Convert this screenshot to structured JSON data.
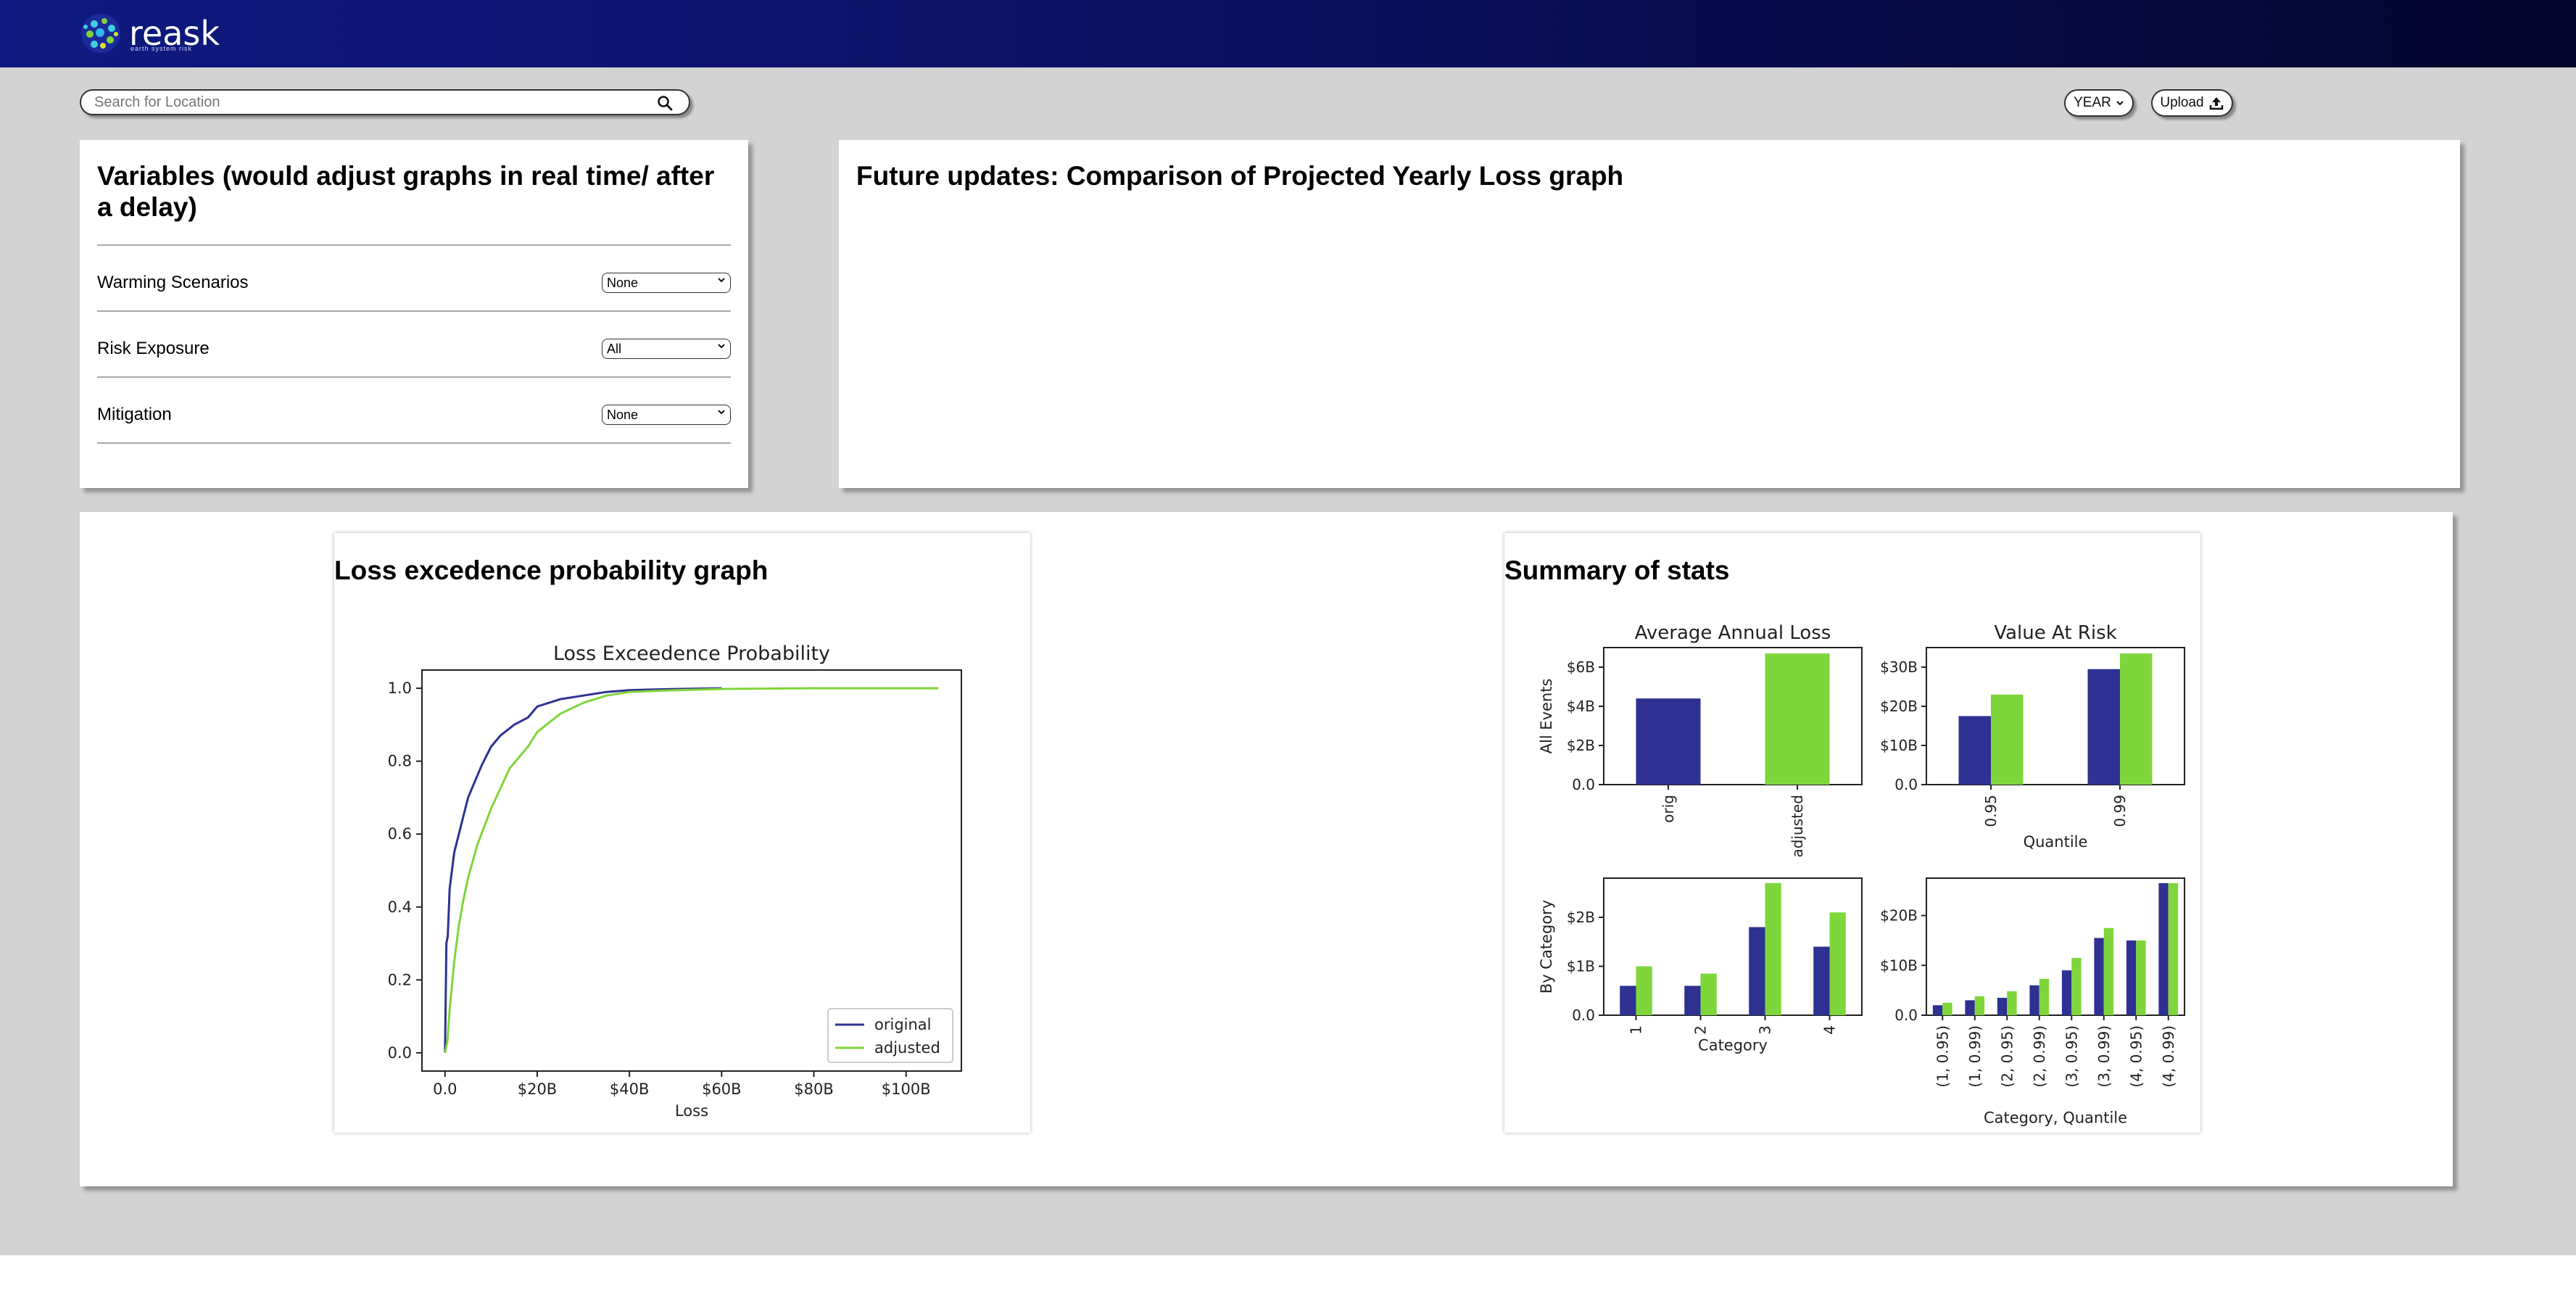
{
  "brand": {
    "name": "reask",
    "tagline": "earth system risk"
  },
  "search": {
    "placeholder": "Search for Location"
  },
  "toolbar": {
    "period": "YEAR",
    "upload_label": "Upload"
  },
  "variables": {
    "title": "Variables (would adjust graphs in real time/ after a delay)",
    "items": [
      {
        "label": "Warming Scenarios",
        "value": "None"
      },
      {
        "label": "Risk Exposure",
        "value": "All"
      },
      {
        "label": "Mitigation",
        "value": "None"
      }
    ]
  },
  "future": {
    "title": "Future updates: Comparison of Projected Yearly Loss graph"
  },
  "loss_section": {
    "title": "Loss excedence probability graph"
  },
  "stats_section": {
    "title": "Summary of stats"
  },
  "colors": {
    "original": "#2e3192",
    "adjusted": "#7fd63b"
  },
  "chart_data": [
    {
      "type": "line",
      "title": "Loss Exceedence Probability",
      "xlabel": "Loss",
      "ylabel": "",
      "xlim": [
        -5,
        112
      ],
      "ylim": [
        -0.05,
        1.05
      ],
      "xticks": [
        0,
        20,
        40,
        60,
        80,
        100
      ],
      "xtick_labels": [
        "0.0",
        "$20B",
        "$40B",
        "$60B",
        "$80B",
        "$100B"
      ],
      "yticks": [
        0,
        0.2,
        0.4,
        0.6,
        0.8,
        1.0
      ],
      "ytick_labels": [
        "0.0",
        "0.2",
        "0.4",
        "0.6",
        "0.8",
        "1.0"
      ],
      "legend": "lower-right",
      "series": [
        {
          "name": "original",
          "x": [
            0,
            0.3,
            0.6,
            1,
            2,
            3,
            4,
            5,
            6,
            8,
            10,
            12,
            15,
            18,
            20,
            25,
            30,
            35,
            40,
            50,
            60
          ],
          "y": [
            0.0,
            0.3,
            0.32,
            0.45,
            0.55,
            0.6,
            0.65,
            0.7,
            0.73,
            0.79,
            0.84,
            0.87,
            0.9,
            0.92,
            0.95,
            0.97,
            0.98,
            0.99,
            0.995,
            0.998,
            1.0
          ]
        },
        {
          "name": "adjusted",
          "x": [
            0,
            0.5,
            1,
            2,
            3,
            4,
            5,
            7,
            10,
            14,
            18,
            20,
            25,
            30,
            35,
            40,
            50,
            60,
            80,
            100,
            107
          ],
          "y": [
            0.0,
            0.03,
            0.12,
            0.25,
            0.35,
            0.42,
            0.48,
            0.57,
            0.67,
            0.78,
            0.84,
            0.88,
            0.93,
            0.96,
            0.98,
            0.99,
            0.995,
            0.998,
            1.0,
            1.0,
            1.0
          ]
        }
      ]
    },
    {
      "type": "bar",
      "title": "Average Annual Loss",
      "ylabel": "All Events",
      "categories": [
        "orig",
        "adjusted"
      ],
      "values": [
        4.4,
        6.7
      ],
      "ylim": [
        0,
        7
      ],
      "yticks": [
        0,
        2,
        4,
        6
      ],
      "ytick_labels": [
        "0.0",
        "$2B",
        "$4B",
        "$6B"
      ]
    },
    {
      "type": "bar",
      "title": "Value At Risk",
      "xlabel": "Quantile",
      "categories": [
        "0.95",
        "0.99"
      ],
      "series": [
        {
          "name": "original",
          "values": [
            17.5,
            29.5
          ]
        },
        {
          "name": "adjusted",
          "values": [
            23,
            33.5
          ]
        }
      ],
      "ylim": [
        0,
        35
      ],
      "yticks": [
        0,
        10,
        20,
        30
      ],
      "ytick_labels": [
        "0.0",
        "$10B",
        "$20B",
        "$30B"
      ]
    },
    {
      "type": "bar",
      "ylabel": "By Category",
      "xlabel": "Category",
      "categories": [
        "1",
        "2",
        "3",
        "4"
      ],
      "series": [
        {
          "name": "original",
          "values": [
            0.6,
            0.6,
            1.8,
            1.4
          ]
        },
        {
          "name": "adjusted",
          "values": [
            1.0,
            0.85,
            2.7,
            2.1
          ]
        }
      ],
      "ylim": [
        0,
        2.8
      ],
      "yticks": [
        0,
        1,
        2
      ],
      "ytick_labels": [
        "0.0",
        "$1B",
        "$2B"
      ]
    },
    {
      "type": "bar",
      "xlabel": "Category, Quantile",
      "categories": [
        "(1, 0.95)",
        "(1, 0.99)",
        "(2, 0.95)",
        "(2, 0.99)",
        "(3, 0.95)",
        "(3, 0.99)",
        "(4, 0.95)",
        "(4, 0.99)"
      ],
      "series": [
        {
          "name": "original",
          "values": [
            2,
            3,
            3.5,
            6,
            9,
            15.5,
            15,
            26.5
          ]
        },
        {
          "name": "adjusted",
          "values": [
            2.5,
            3.8,
            4.8,
            7.3,
            11.5,
            17.5,
            15,
            26.5
          ]
        }
      ],
      "ylim": [
        0,
        27.5
      ],
      "yticks": [
        0,
        10,
        20
      ],
      "ytick_labels": [
        "0.0",
        "$10B",
        "$20B"
      ]
    }
  ]
}
